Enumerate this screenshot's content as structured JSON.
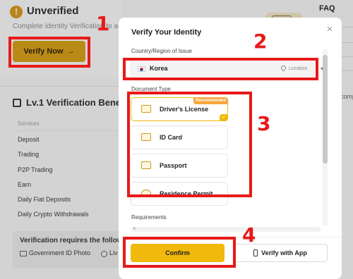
{
  "background": {
    "status_title": "Unverified",
    "status_subtitle": "Complete Identity Verification to acc",
    "verify_button": "Verify Now",
    "verify_arrow": "→",
    "benefits_title": "Lv.1 Verification Benefits",
    "services_header": "Services",
    "services": [
      "Deposit",
      "Trading",
      "P2P Trading",
      "Earn",
      "Daily Fiat Deposits",
      "Daily Crypto Withdrawals"
    ],
    "requirements_title": "Verification requires the following",
    "req_items": [
      "Government ID Photo",
      "Liv"
    ],
    "faq": "FAQ",
    "right_fragment": "comp"
  },
  "modal": {
    "title": "Verify Your Identity",
    "close_symbol": "×",
    "country_label": "Country/Region of Issue",
    "country_value": "Korea",
    "location_hint": "Location",
    "document_type_label": "Document Type",
    "documents": [
      {
        "label": "Driver's License",
        "badge": "Recommended",
        "selected": true
      },
      {
        "label": "ID Card",
        "selected": false
      },
      {
        "label": "Passport",
        "selected": false
      },
      {
        "label": "Residence Permit",
        "selected": false
      }
    ],
    "selected_check": "✓",
    "requirements_label": "Requirements",
    "confirm_button": "Confirm",
    "app_button": "Verify with App"
  },
  "annotations": {
    "numbers": [
      "1",
      "2",
      "3",
      "4"
    ],
    "color": "#e81919"
  },
  "colors": {
    "accent": "#f0b90b",
    "badge": "#f6a53a"
  }
}
